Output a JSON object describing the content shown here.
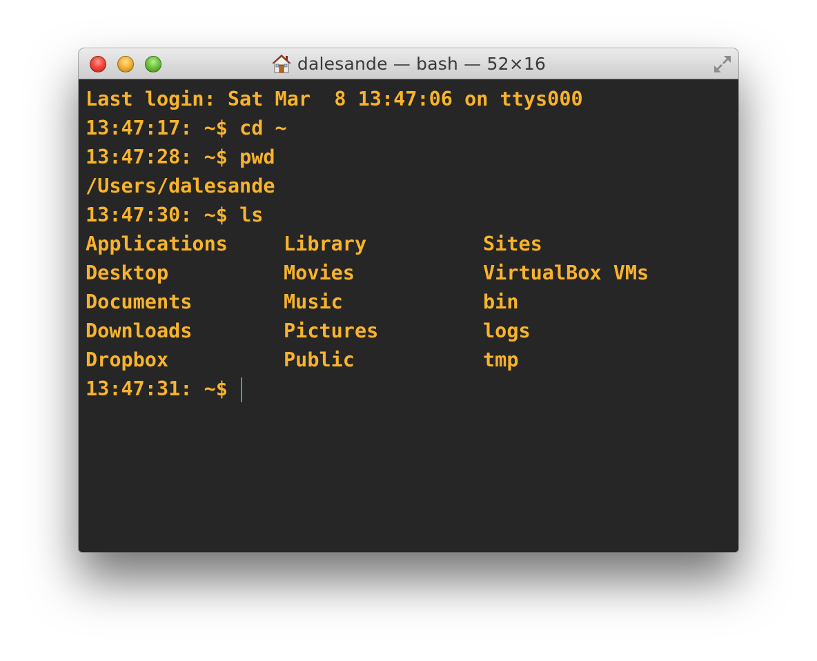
{
  "window": {
    "title": "dalesande — bash — 52×16",
    "title_icon": "home-icon"
  },
  "colors": {
    "text": "#f8b32d",
    "background": "#262626",
    "cursor": "#22c23a"
  },
  "terminal": {
    "last_login": "Last login: Sat Mar  8 13:47:06 on ttys000",
    "commands": [
      {
        "prompt": "13:47:17: ~$ ",
        "command": "cd ~"
      },
      {
        "prompt": "13:47:28: ~$ ",
        "command": "pwd"
      }
    ],
    "pwd_output": "/Users/dalesande",
    "ls_prompt": "13:47:30: ~$ ",
    "ls_command": "ls",
    "ls_output": [
      [
        "Applications",
        "Library",
        "Sites"
      ],
      [
        "Desktop",
        "Movies",
        "VirtualBox VMs"
      ],
      [
        "Documents",
        "Music",
        "bin"
      ],
      [
        "Downloads",
        "Pictures",
        "logs"
      ],
      [
        "Dropbox",
        "Public",
        "tmp"
      ]
    ],
    "current_prompt": "13:47:31: ~$ "
  }
}
